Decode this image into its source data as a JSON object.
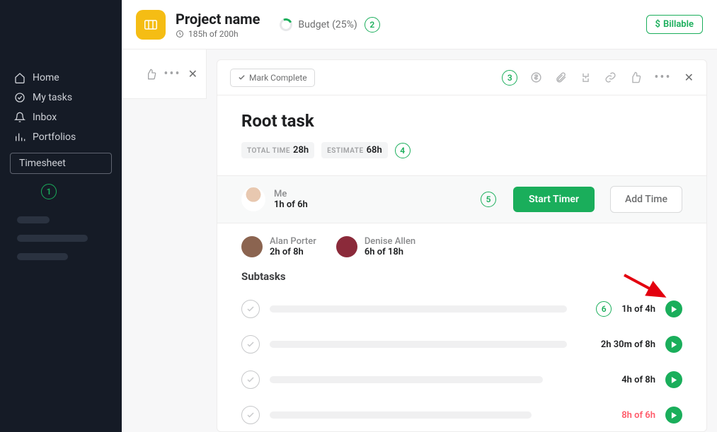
{
  "sidebar": {
    "items": [
      {
        "label": "Home"
      },
      {
        "label": "My tasks"
      },
      {
        "label": "Inbox"
      },
      {
        "label": "Portfolios"
      },
      {
        "label": "Timesheet"
      }
    ],
    "annotation": "1"
  },
  "header": {
    "project_title": "Project name",
    "hours_used": "185h of 200h",
    "budget_label": "Budget (25%)",
    "annotation": "2",
    "billable_label": "Billable"
  },
  "panel": {
    "mark_complete": "Mark Complete",
    "annotation": "3",
    "task_title": "Root task",
    "total_time_label": "TOTAL TIME",
    "total_time_value": "28h",
    "estimate_label": "ESTIMATE",
    "estimate_value": "68h",
    "estimate_annotation": "4"
  },
  "me": {
    "name": "Me",
    "hours": "1h of 6h",
    "annotation": "5",
    "start_timer": "Start Timer",
    "add_time": "Add Time"
  },
  "assignees": [
    {
      "name": "Alan Porter",
      "hours": "2h of 8h",
      "avatar": "av-alan"
    },
    {
      "name": "Denise Allen",
      "hours": "6h of 18h",
      "avatar": "av-denise"
    }
  ],
  "subtasks": {
    "title": "Subtasks",
    "annotation": "6",
    "rows": [
      {
        "time": "1h of 4h",
        "over": false
      },
      {
        "time": "2h 30m of 8h",
        "over": false
      },
      {
        "time": "4h of 8h",
        "over": false
      },
      {
        "time": "8h of 6h",
        "over": true
      }
    ]
  }
}
